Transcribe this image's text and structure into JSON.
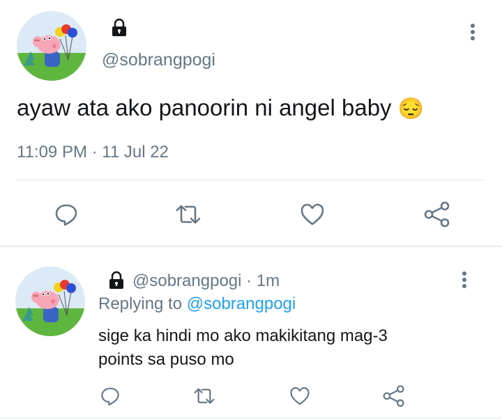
{
  "tweet": {
    "handle": "@sobrangpogi",
    "text": "ayaw ata ako panoorin ni angel baby",
    "emoji": "😔",
    "timestamp": "11:09 PM · 11 Jul 22",
    "actions": [
      "reply-icon",
      "retweet-icon",
      "like-icon",
      "share-icon"
    ]
  },
  "reply": {
    "handle": "@sobrangpogi",
    "separator": " · ",
    "time": "1m",
    "replying_prefix": "Replying to ",
    "replying_to": "@sobrangpogi",
    "line1": "sige ka hindi mo ako makikitang mag-3",
    "line2": "points sa puso mo",
    "actions": [
      "reply-icon",
      "retweet-icon",
      "like-icon",
      "share-icon"
    ]
  },
  "colors": {
    "text": "#14171a",
    "secondary": "#657786",
    "link": "#1da1f2",
    "divider": "#e1e8ed"
  }
}
